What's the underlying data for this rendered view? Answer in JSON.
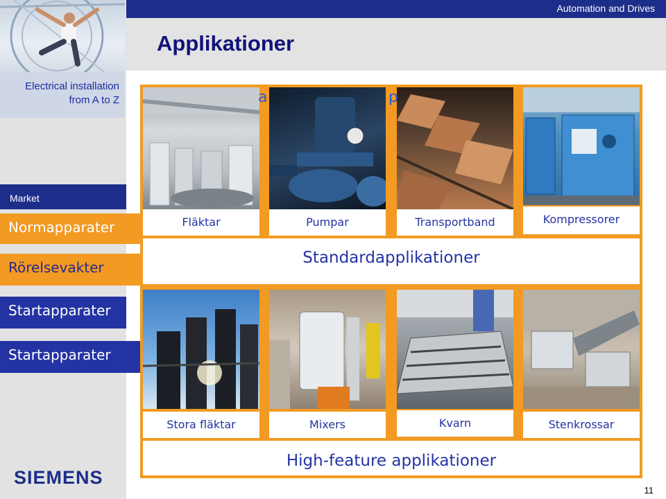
{
  "header": {
    "brand_division": "Automation and Drives",
    "title": "Applikationer"
  },
  "sidebar": {
    "title_line1": "Electrical installation",
    "title_line2": "from A to Z",
    "section_label": "Market",
    "items": [
      {
        "label": "Normapparater"
      },
      {
        "label": "Rörelsevakter"
      },
      {
        "label": "Startapparater"
      },
      {
        "label": "Startapparater"
      }
    ],
    "logo": "SIEMENS"
  },
  "standard": {
    "band_label": "Standardapplikationer",
    "items": [
      {
        "label": "Fläktar",
        "icon": "ventilation-photo"
      },
      {
        "label": "Pumpar",
        "icon": "pump-photo"
      },
      {
        "label": "Transportband",
        "icon": "conveyor-photo"
      },
      {
        "label": "Kompressorer",
        "icon": "compressor-photo"
      }
    ]
  },
  "high_feature": {
    "band_label": "High-feature applikationer",
    "items": [
      {
        "label": "Stora fläktar",
        "icon": "towers-photo"
      },
      {
        "label": "Mixers",
        "icon": "mixer-photo"
      },
      {
        "label": "Kvarn",
        "icon": "mill-photo"
      },
      {
        "label": "Stenkrossar",
        "icon": "crusher-photo"
      }
    ]
  },
  "page_number": "11",
  "colors": {
    "navy": "#1d2e8a",
    "orange": "#f29a21",
    "blue_text": "#2433a3"
  }
}
